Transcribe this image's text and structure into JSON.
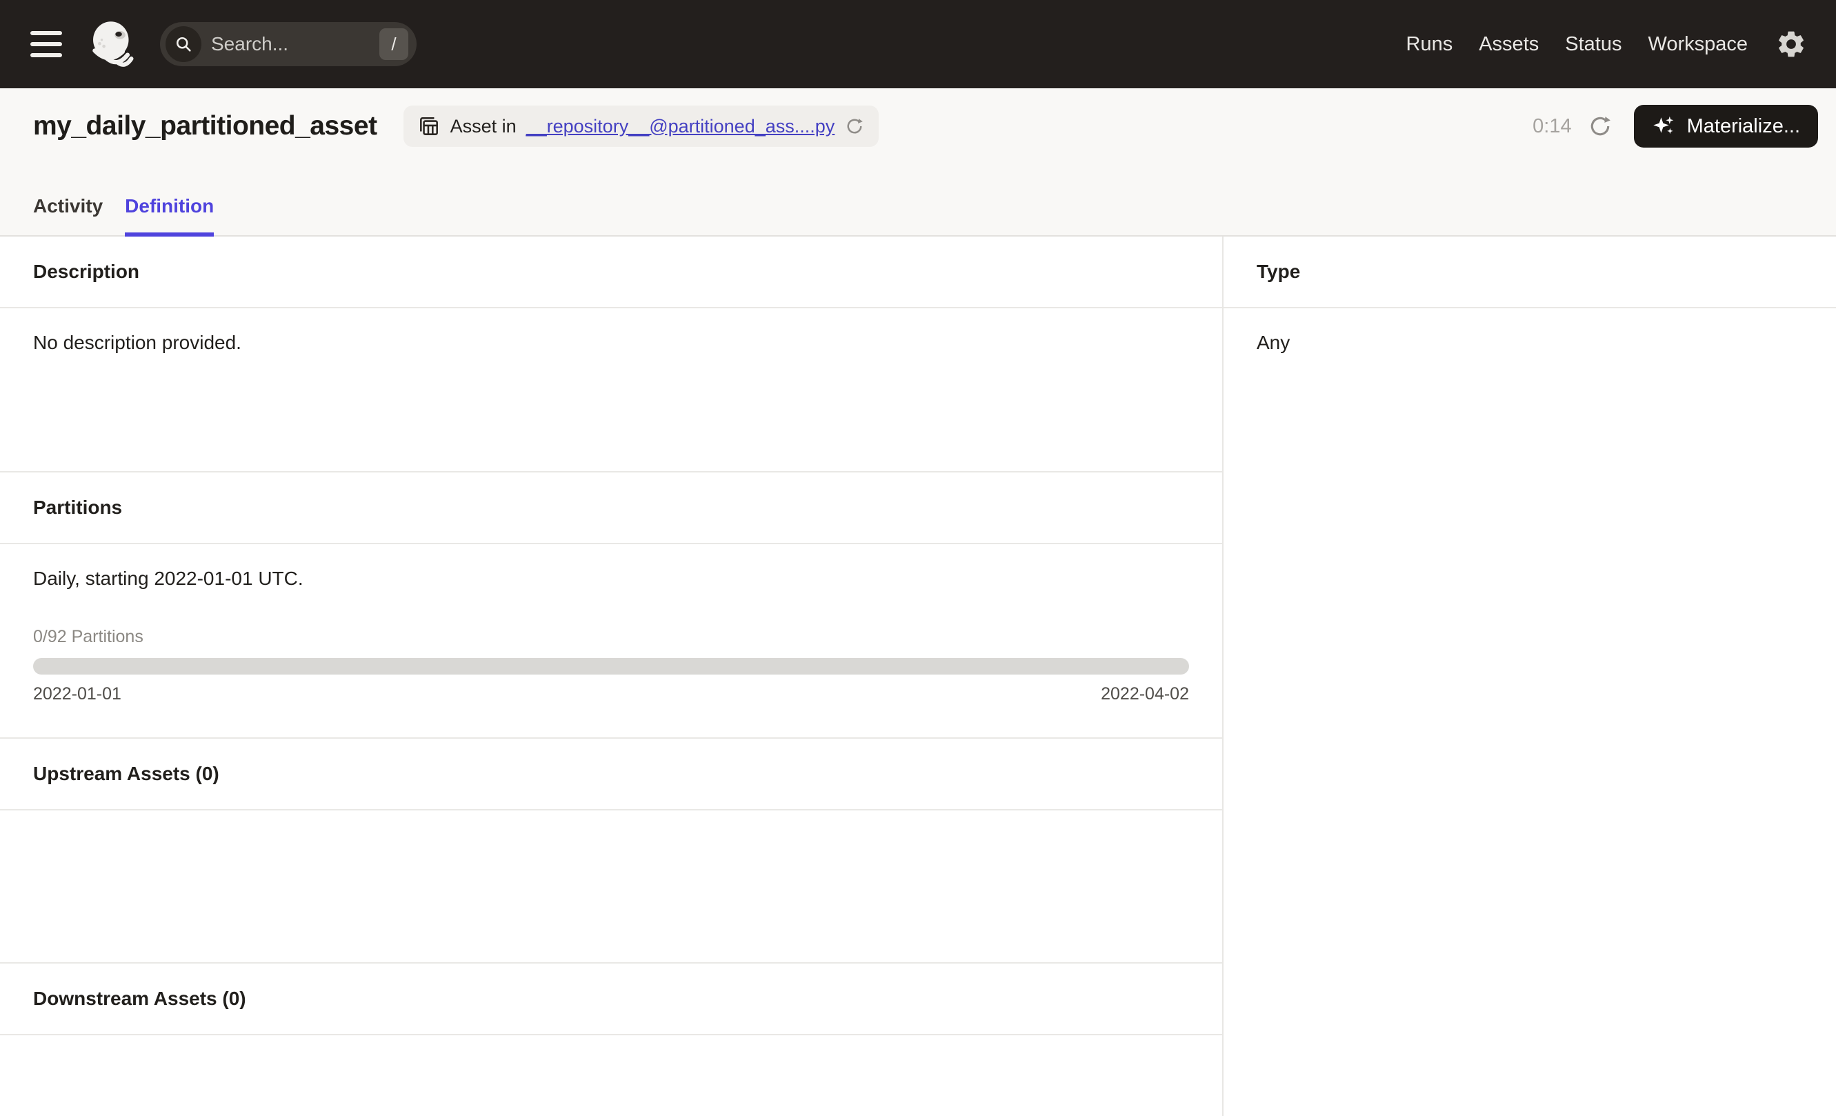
{
  "navbar": {
    "search": {
      "placeholder": "Search...",
      "shortcut_key": "/"
    },
    "items": [
      {
        "label": "Runs"
      },
      {
        "label": "Assets"
      },
      {
        "label": "Status"
      },
      {
        "label": "Workspace"
      }
    ]
  },
  "header": {
    "title": "my_daily_partitioned_asset",
    "asset_badge": {
      "prefix": "Asset in",
      "link_text": "__repository__@partitioned_ass....py"
    },
    "refresh_timer": "0:14",
    "materialize_label": "Materialize..."
  },
  "tabs": [
    {
      "label": "Activity",
      "active": false
    },
    {
      "label": "Definition",
      "active": true
    }
  ],
  "left": {
    "description": {
      "heading": "Description",
      "empty_text": "No description provided."
    },
    "partitions": {
      "heading": "Partitions",
      "summary": "Daily, starting 2022-01-01 UTC.",
      "progress_label": "0/92 Partitions",
      "progress_pct": 0,
      "range_start": "2022-01-01",
      "range_end": "2022-04-02"
    },
    "upstream": {
      "heading": "Upstream Assets (0)"
    },
    "downstream": {
      "heading": "Downstream Assets (0)"
    }
  },
  "right": {
    "type": {
      "heading": "Type",
      "value": "Any"
    }
  },
  "colors": {
    "accent": "#4F43DD",
    "link": "#4440C2",
    "navbar_bg": "#231F1D",
    "header_bg": "#F9F8F6",
    "progress_track": "#D9D8D5"
  },
  "icons": {
    "menu": "hamburger-bars",
    "logo": "dagster-octopus",
    "search": "magnifier",
    "settings": "gear",
    "asset_badge": "stacked-table",
    "reload": "circular-arrow",
    "materialize": "sparkles"
  }
}
